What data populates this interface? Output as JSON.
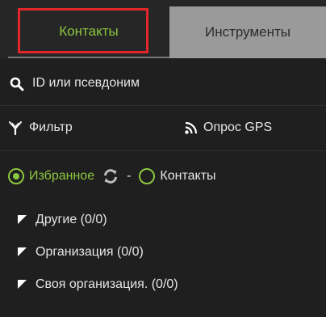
{
  "tabs": [
    {
      "label": "Контакты",
      "active": true
    },
    {
      "label": "Инструменты",
      "active": false
    }
  ],
  "search": {
    "placeholder": "ID или псевдоним",
    "icon": "search-icon"
  },
  "toolbar": {
    "filter_label": "Фильтр",
    "gps_label": "Опрос GPS"
  },
  "mode": {
    "favorites_label": "Избранное",
    "separator": "-",
    "contacts_label": "Контакты",
    "selected": "favorites"
  },
  "groups": [
    {
      "label": "Другие (0/0)"
    },
    {
      "label": "Организация (0/0)"
    },
    {
      "label": "Своя организация. (0/0)"
    }
  ],
  "colors": {
    "accent": "#8cc63f",
    "background": "#1f1f1f",
    "tab_inactive": "#9a9a9a",
    "highlight": "#e3262b"
  }
}
